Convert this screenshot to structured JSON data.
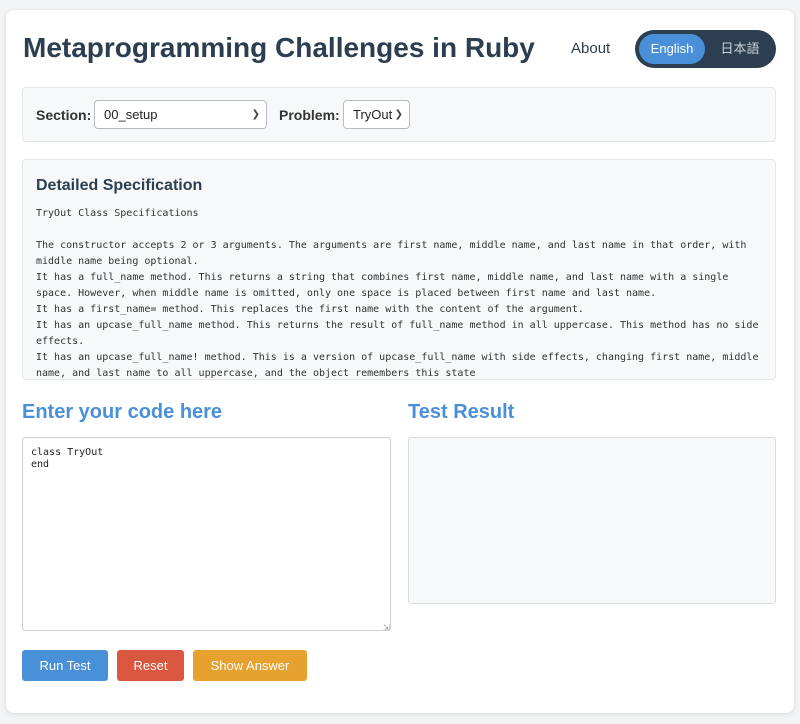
{
  "header": {
    "title": "Metaprogramming Challenges in Ruby",
    "about_label": "About",
    "lang_english": "English",
    "lang_japanese": "日本語"
  },
  "selectors": {
    "section_label": "Section:",
    "section_value": "00_setup",
    "problem_label": "Problem:",
    "problem_value": "TryOut"
  },
  "spec": {
    "heading": "Detailed Specification",
    "lines": [
      "TryOut Class Specifications",
      "",
      "The constructor accepts 2 or 3 arguments. The arguments are first name, middle name, and last name in that order, with middle name being optional.",
      "It has a full_name method. This returns a string that combines first name, middle name, and last name with a single space. However, when middle name is omitted, only one space is placed between first name and last name.",
      "It has a first_name= method. This replaces the first name with the content of the argument.",
      "It has an upcase_full_name method. This returns the result of full_name method in all uppercase. This method has no side effects.",
      "It has an upcase_full_name! method. This is a version of upcase_full_name with side effects, changing first name, middle name, and last name to all uppercase, and the object remembers this state"
    ]
  },
  "editor": {
    "heading": "Enter your code here",
    "code": "class TryOut\nend"
  },
  "result": {
    "heading": "Test Result",
    "content": ""
  },
  "actions": {
    "run_label": "Run Test",
    "reset_label": "Reset",
    "answer_label": "Show Answer"
  },
  "colors": {
    "accent": "#4a90d9",
    "title": "#2c3e50",
    "reset": "#d9573f",
    "answer": "#e6a12f"
  }
}
